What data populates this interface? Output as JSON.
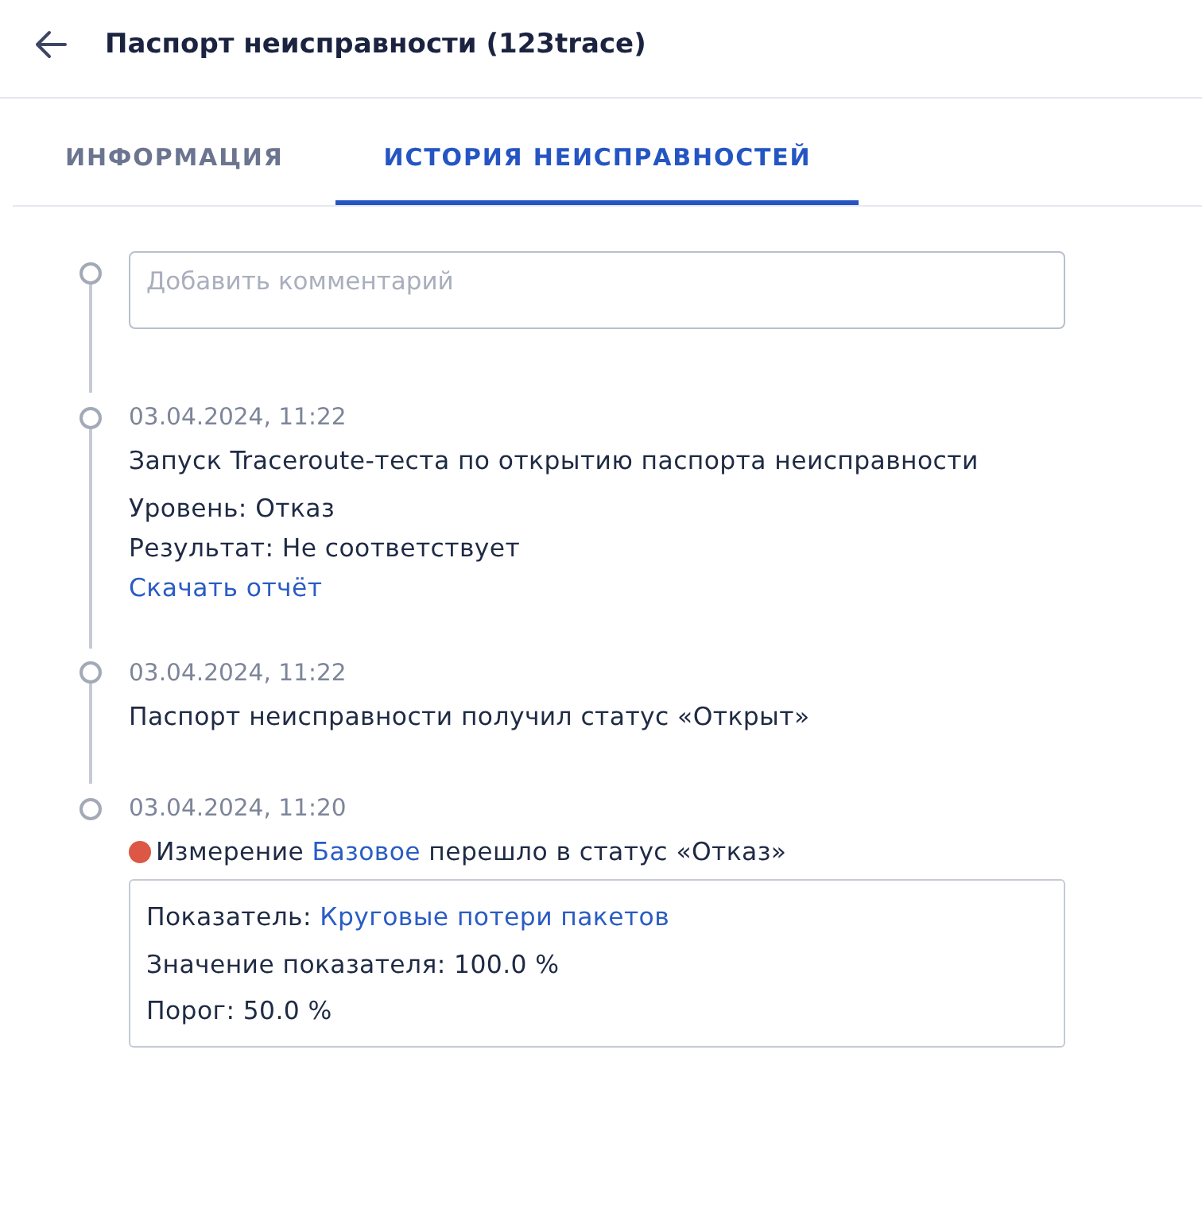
{
  "header": {
    "title": "Паспорт неисправности (123trace)"
  },
  "tabs": [
    {
      "label": "ИНФОРМАЦИЯ",
      "selected": false
    },
    {
      "label": "ИСТОРИЯ НЕИСПРАВНОСТЕЙ",
      "selected": true
    }
  ],
  "comment": {
    "placeholder": "Добавить комментарий"
  },
  "events": [
    {
      "time": "03.04.2024, 11:22",
      "lines": [
        {
          "kind": "text",
          "text": "Запуск Traceroute-теста по открытию паспорта неисправности"
        },
        {
          "kind": "text",
          "text": "Уровень: Отказ"
        },
        {
          "kind": "text",
          "text": "Результат: Не соответствует"
        },
        {
          "kind": "link",
          "text": "Скачать отчёт"
        }
      ]
    },
    {
      "time": "03.04.2024, 11:22",
      "lines": [
        {
          "kind": "text",
          "text": "Паспорт неисправности получил статус «Открыт»"
        }
      ]
    },
    {
      "time": "03.04.2024, 11:20",
      "lines": [
        {
          "kind": "status",
          "color": "#dc5845",
          "before": "Измерение",
          "link": "Базовое",
          "after": "перешло в статус «Отказ»"
        }
      ],
      "details": [
        {
          "kind": "link_line",
          "before": "Показатель:",
          "link": "Круговые потери пакетов"
        },
        {
          "kind": "text",
          "text": "Значение показателя: 100.0 %"
        },
        {
          "kind": "text",
          "text": "Порог: 50.0 %"
        }
      ]
    }
  ]
}
